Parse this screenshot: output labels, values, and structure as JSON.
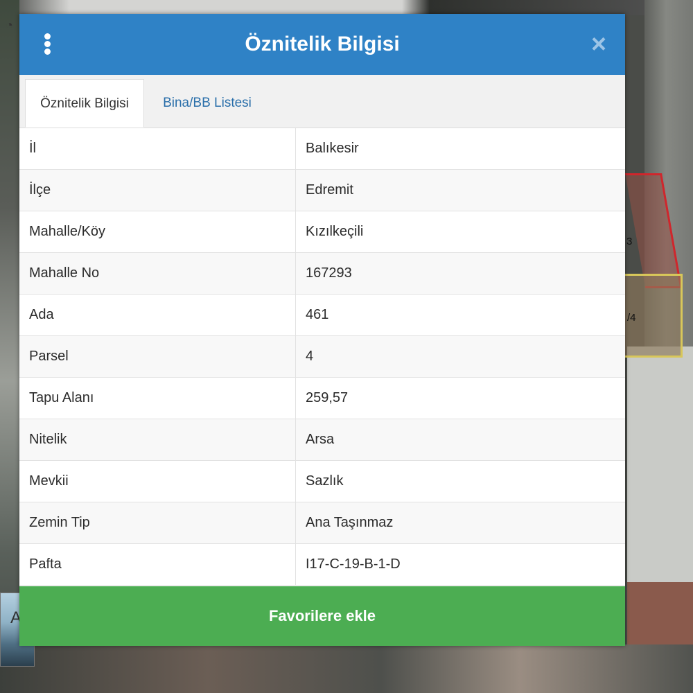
{
  "dialog": {
    "title": "Öznitelik Bilgisi",
    "close_symbol": "×"
  },
  "tabs": [
    {
      "label": "Öznitelik Bilgisi",
      "active": true
    },
    {
      "label": "Bina/BB Listesi",
      "active": false
    }
  ],
  "attributes": [
    {
      "key": "İl",
      "value": "Balıkesir"
    },
    {
      "key": "İlçe",
      "value": "Edremit"
    },
    {
      "key": "Mahalle/Köy",
      "value": "Kızılkeçili"
    },
    {
      "key": "Mahalle No",
      "value": "167293"
    },
    {
      "key": "Ada",
      "value": "461"
    },
    {
      "key": "Parsel",
      "value": "4"
    },
    {
      "key": "Tapu Alanı",
      "value": "259,57"
    },
    {
      "key": "Nitelik",
      "value": "Arsa"
    },
    {
      "key": "Mevkii",
      "value": "Sazlık"
    },
    {
      "key": "Zemin Tip",
      "value": "Ana Taşınmaz"
    },
    {
      "key": "Pafta",
      "value": "I17-C-19-B-1-D"
    }
  ],
  "actions": {
    "favorite_label": "Favorilere ekle"
  },
  "map": {
    "parcel_label": "/4",
    "neighbor_label": "3",
    "control_glyph": "◔",
    "thumb_letter": "A"
  },
  "colors": {
    "header": "#2f82c6",
    "tab_link": "#2a6faa",
    "favorite_button": "#4cad52",
    "parcel_selected": "#d0262c",
    "parcel_neighbor": "#d8c75a"
  },
  "icons": {
    "menu": "kebab-menu-icon",
    "close": "close-icon"
  }
}
